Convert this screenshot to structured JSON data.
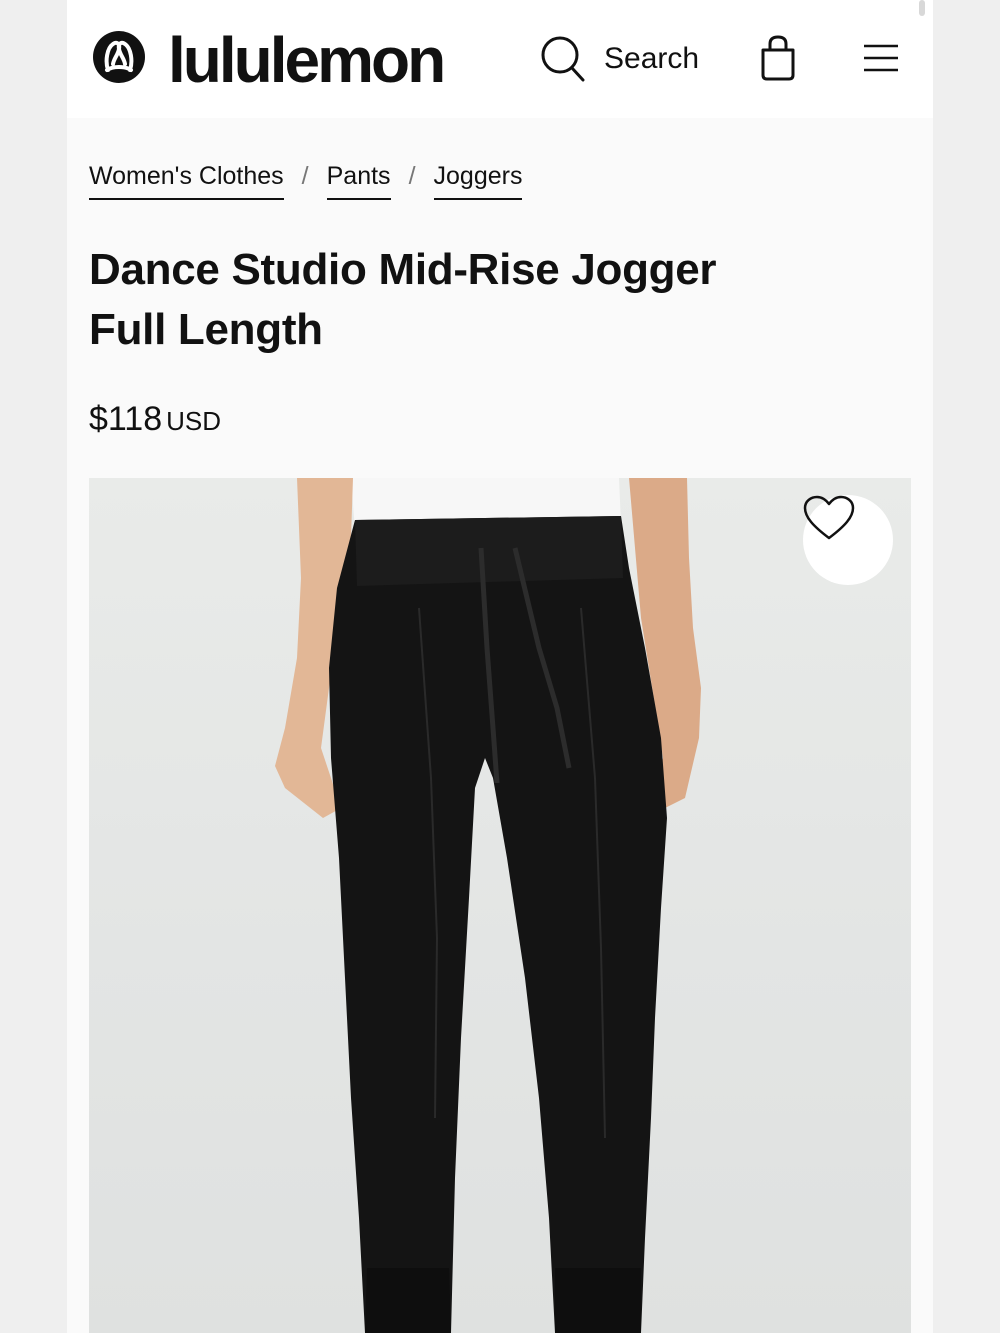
{
  "header": {
    "brand": "lululemon",
    "search_label": "Search",
    "icons": {
      "logo": "lululemon-logo-icon",
      "search": "search-icon",
      "bag": "shopping-bag-icon",
      "menu": "hamburger-menu-icon"
    }
  },
  "breadcrumb": {
    "items": [
      "Women's Clothes",
      "Pants",
      "Joggers"
    ],
    "separator": "/"
  },
  "product": {
    "title_line1": "Dance Studio Mid-Rise Jogger",
    "title_line2": "Full Length",
    "price": "$118",
    "currency": "USD",
    "wishlist_icon": "heart-icon",
    "image_description_icon": "product-photo"
  },
  "colors": {
    "text": "#111111",
    "header_bg": "#ffffff",
    "page_bg": "#fafafa",
    "pants": "#141414"
  }
}
